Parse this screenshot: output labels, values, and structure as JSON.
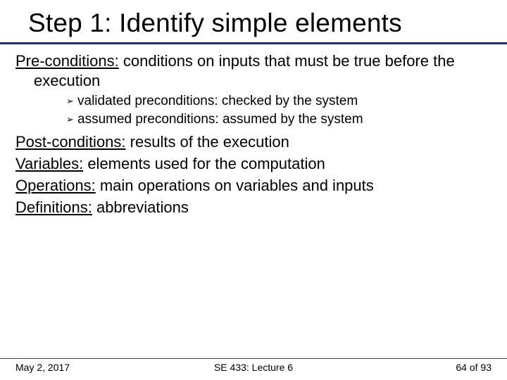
{
  "title": "Step 1: Identify simple elements",
  "precond": {
    "term": "Pre-conditions:",
    "rest": " conditions on inputs that must be true before the execution",
    "items": [
      "validated preconditions: checked by the system",
      "assumed preconditions: assumed by the system"
    ]
  },
  "defs": [
    {
      "term": "Post-conditions:",
      "rest": " results of the execution"
    },
    {
      "term": "Variables:",
      "rest": " elements used for the computation"
    },
    {
      "term": "Operations:",
      "rest": " main operations on variables and inputs"
    },
    {
      "term": "Definitions:",
      "rest": " abbreviations"
    }
  ],
  "footer": {
    "date": "May 2, 2017",
    "course": "SE 433: Lecture 6",
    "page": "64 of 93"
  }
}
